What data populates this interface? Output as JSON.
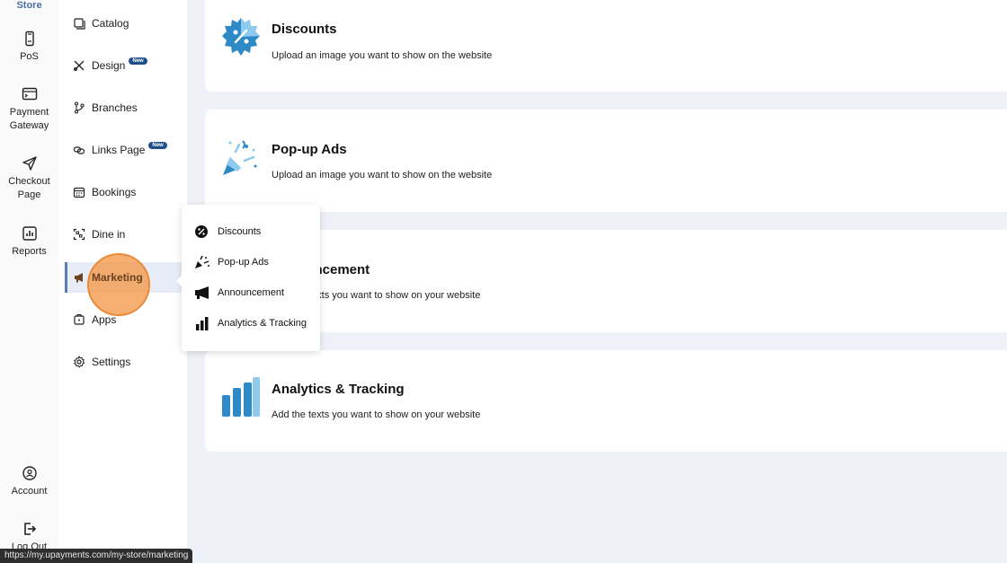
{
  "rail": {
    "store_label": "Store",
    "items": [
      {
        "label": "PoS",
        "icon": "phone-icon"
      },
      {
        "label": "Payment\nGateway",
        "icon": "terminal-icon"
      },
      {
        "label": "Checkout\nPage",
        "icon": "send-icon"
      },
      {
        "label": "Reports",
        "icon": "chart-icon"
      },
      {
        "label": "Account",
        "icon": "account-icon"
      },
      {
        "label": "Log Out",
        "icon": "logout-icon"
      }
    ]
  },
  "sidebar": {
    "items": [
      {
        "label": "Catalog",
        "icon": "catalog-icon"
      },
      {
        "label": "Design",
        "icon": "design-icon",
        "badge": "New"
      },
      {
        "label": "Branches",
        "icon": "branches-icon"
      },
      {
        "label": "Links Page",
        "icon": "links-icon",
        "badge": "New"
      },
      {
        "label": "Bookings",
        "icon": "calendar-icon"
      },
      {
        "label": "Dine in",
        "icon": "qr-icon"
      },
      {
        "label": "Marketing",
        "icon": "megaphone-icon",
        "active": true
      },
      {
        "label": "Apps",
        "icon": "apps-icon"
      },
      {
        "label": "Settings",
        "icon": "gear-icon"
      }
    ]
  },
  "cards": [
    {
      "title": "Discounts",
      "description": "Upload an image you want to show on the website",
      "icon": "discount-badge-icon"
    },
    {
      "title": "Pop-up Ads",
      "description": "Upload an image you want to show on the website",
      "icon": "party-popper-icon"
    },
    {
      "title": "Announcement",
      "description": "Add the texts you want to show on your website",
      "icon": "megaphone-icon"
    },
    {
      "title": "Analytics & Tracking",
      "description": "Add the texts you want to show on your website",
      "icon": "bar-chart-icon"
    }
  ],
  "popup": {
    "items": [
      {
        "label": "Discounts",
        "icon": "discount-icon"
      },
      {
        "label": "Pop-up Ads",
        "icon": "party-popper-icon"
      },
      {
        "label": "Announcement",
        "icon": "megaphone-icon"
      },
      {
        "label": "Analytics & Tracking",
        "icon": "bar-chart-icon"
      }
    ]
  },
  "status_url": "https://my.upayments.com/my-store/marketing",
  "colors": {
    "accent": "#5b7bb8",
    "icon_blue_light": "#8ec9ef",
    "icon_blue_dark": "#2d8ac7",
    "highlight": "#f49848"
  }
}
